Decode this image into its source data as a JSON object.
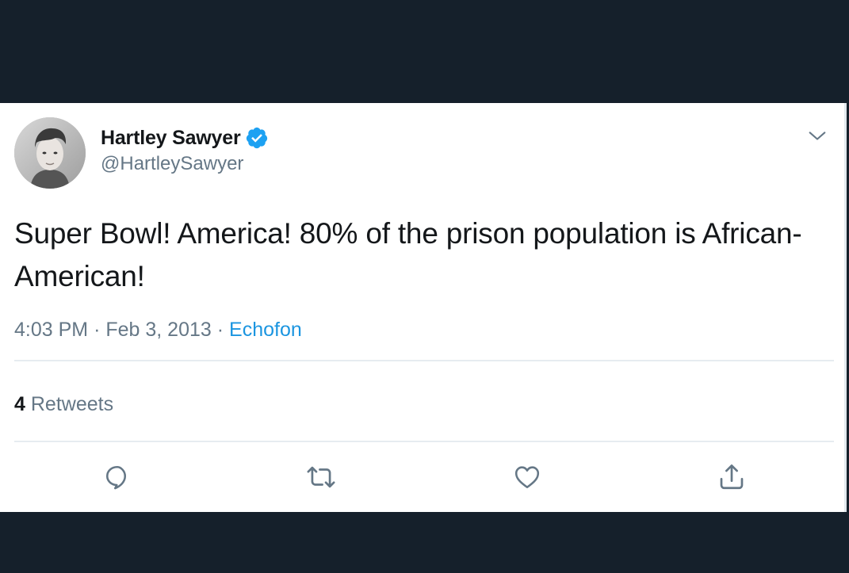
{
  "tweet": {
    "author": {
      "display_name": "Hartley Sawyer",
      "handle": "@HartleySawyer",
      "verified": true
    },
    "text": "Super Bowl! America! 80% of the prison population is African-American!",
    "time": "4:03 PM",
    "date": "Feb 3, 2013",
    "separator": "·",
    "source": "Echofon",
    "stats": {
      "retweet_count": "4",
      "retweet_label": "Retweets"
    },
    "actions": {
      "reply_icon": "reply-icon",
      "retweet_icon": "retweet-icon",
      "like_icon": "like-icon",
      "share_icon": "share-icon"
    }
  },
  "colors": {
    "background": "#15202b",
    "card": "#ffffff",
    "text": "#14171a",
    "muted": "#657786",
    "link": "#1b95e0",
    "verified": "#1da1f2",
    "divider": "#e6ecf0"
  }
}
